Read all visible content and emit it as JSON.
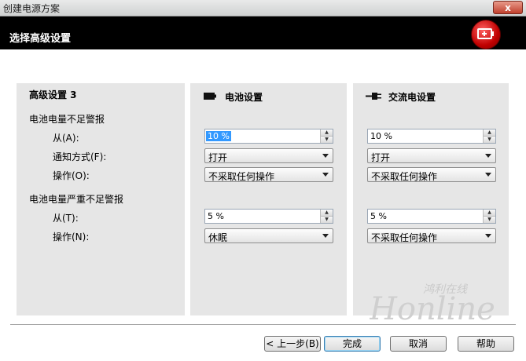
{
  "window": {
    "title": "创建电源方案",
    "close_symbol": "x"
  },
  "header": {
    "heading": "选择高级设置",
    "badge_icon": "battery-plus-icon"
  },
  "settings": {
    "title": "高级设置 3",
    "low_battery_group": "电池电量不足警报",
    "critical_battery_group": "电池电量严重不足警报",
    "from_a_label": "从(A):",
    "notify_label": "通知方式(F):",
    "action_o_label": "操作(O):",
    "from_t_label": "从(T):",
    "action_n_label": "操作(N):"
  },
  "battery": {
    "title": "电池设置",
    "icon": "battery-icon",
    "low_level": "10 %",
    "notify": "打开",
    "low_action": "不采取任何操作",
    "critical_level": "5 %",
    "critical_action": "休眠"
  },
  "ac": {
    "title": "交流电设置",
    "icon": "plug-icon",
    "low_level": "10 %",
    "notify": "打开",
    "low_action": "不采取任何操作",
    "critical_level": "5 %",
    "critical_action": "不采取任何操作"
  },
  "buttons": {
    "back": "< 上一步(B)",
    "finish": "完成",
    "cancel": "取消",
    "help": "帮助"
  },
  "watermark": {
    "text": "Honline",
    "subtitle": "鸿利在线"
  },
  "colors": {
    "header_bg": "#000000",
    "panel_bg": "#e6e6e6",
    "accent_red": "#c00000",
    "selection": "#3399ff"
  }
}
